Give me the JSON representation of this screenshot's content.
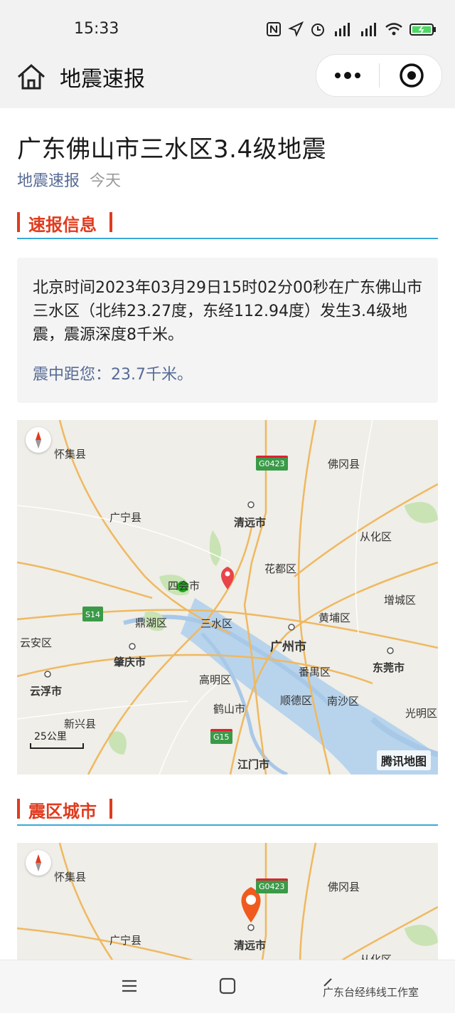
{
  "status_bar": {
    "time": "15:33"
  },
  "nav": {
    "title": "地震速报"
  },
  "article": {
    "title": "广东佛山市三水区3.4级地震",
    "source": "地震速报",
    "date": "今天"
  },
  "sections": {
    "info_title": "速报信息",
    "cities_title": "震区城市"
  },
  "info": {
    "description": "北京时间2023年03月29日15时02分00秒在广东佛山市三水区（北纬23.27度，东经112.94度）发生3.4级地震，震源深度8千米。",
    "distance": "震中距您：23.7千米。"
  },
  "map1": {
    "labels": {
      "huaiji": "怀集县",
      "fogang": "佛冈县",
      "qingyuan": "清远市",
      "guangning": "广宁县",
      "conghua": "从化区",
      "huadu": "花都区",
      "sihui": "四会市",
      "zengcheng": "增城区",
      "dinghu": "鼎湖区",
      "sanshui": "三水区",
      "huangpu": "黄埔区",
      "yunan": "云安区",
      "zhaoqing": "肇庆市",
      "guangzhou": "广州市",
      "dongguan": "东莞市",
      "panyu": "番禺区",
      "yunfu": "云浮市",
      "gaoming": "高明区",
      "shunde": "顺德区",
      "nansha": "南沙区",
      "heshan": "鹤山市",
      "xinxing": "新兴县",
      "guangming": "光明区",
      "jiangmen": "江门市"
    },
    "highways": {
      "g0423": "G0423",
      "s14": "S14",
      "g15": "G15"
    },
    "scale": "25公里",
    "logo": "腾讯地图"
  },
  "map2": {
    "labels": {
      "huaiji": "怀集县",
      "fogang": "佛冈县",
      "qingyuan": "清远市",
      "guangning": "广宁县",
      "conghua": "从化区"
    },
    "highways": {
      "g0423": "G0423"
    }
  },
  "watermark": "广东台经纬线工作室",
  "colors": {
    "accent_red": "#e03b1e",
    "link_blue": "#576b95",
    "divider_blue": "#39a8d6"
  }
}
